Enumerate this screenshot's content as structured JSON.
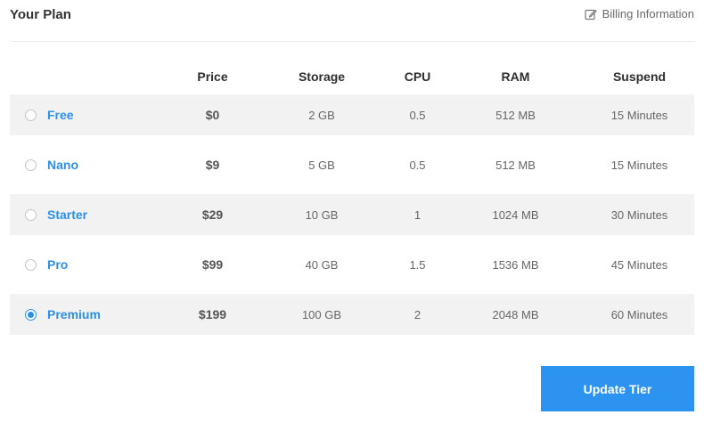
{
  "header": {
    "title": "Your Plan",
    "billing_link": "Billing Information",
    "billing_icon": "edit-icon"
  },
  "table": {
    "columns": [
      "",
      "Price",
      "Storage",
      "CPU",
      "RAM",
      "Suspend"
    ],
    "rows": [
      {
        "name": "Free",
        "price": "$0",
        "storage": "2 GB",
        "cpu": "0.5",
        "ram": "512 MB",
        "suspend": "15 Minutes",
        "selected": false
      },
      {
        "name": "Nano",
        "price": "$9",
        "storage": "5 GB",
        "cpu": "0.5",
        "ram": "512 MB",
        "suspend": "15 Minutes",
        "selected": false
      },
      {
        "name": "Starter",
        "price": "$29",
        "storage": "10 GB",
        "cpu": "1",
        "ram": "1024 MB",
        "suspend": "30 Minutes",
        "selected": false
      },
      {
        "name": "Pro",
        "price": "$99",
        "storage": "40 GB",
        "cpu": "1.5",
        "ram": "1536 MB",
        "suspend": "45 Minutes",
        "selected": false
      },
      {
        "name": "Premium",
        "price": "$199",
        "storage": "100 GB",
        "cpu": "2",
        "ram": "2048 MB",
        "suspend": "60 Minutes",
        "selected": true
      }
    ]
  },
  "actions": {
    "update_label": "Update Tier"
  },
  "colors": {
    "accent": "#2d8fe8",
    "button": "#2d93f0",
    "stripe": "#f2f2f2"
  }
}
